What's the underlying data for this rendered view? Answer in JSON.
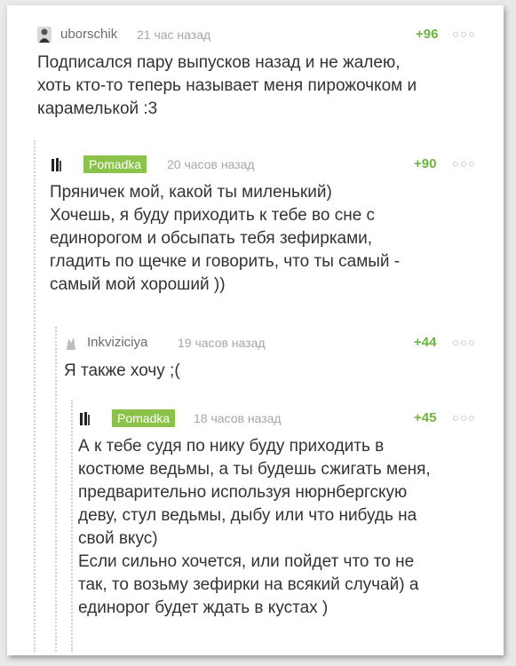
{
  "comments": [
    {
      "username": "uborschik",
      "time": "21 час назад",
      "rating": "+96",
      "avatar_icon": "user-avatar-icon",
      "is_author": false,
      "text": "Подписался пару выпусков назад и не жалею,\nхоть кто-то теперь называет меня пирожочком и\nкарамелькой :3"
    },
    {
      "username": "Pomadka",
      "time": "20 часов назад",
      "rating": "+90",
      "avatar_icon": "user-avatar-icon",
      "is_author": true,
      "text": "Пряничек мой, какой ты миленький)\nХочешь, я буду приходить к тебе во сне с\nединорогом и обсыпать тебя зефирками,\nгладить по щечке и говорить, что ты самый -\nсамый мой хороший ))"
    },
    {
      "username": "Inkviziciya",
      "time": "19 часов назад",
      "rating": "+44",
      "avatar_icon": "user-avatar-icon",
      "is_author": false,
      "text": "Я также хочу ;("
    },
    {
      "username": "Pomadka",
      "time": "18 часов назад",
      "rating": "+45",
      "avatar_icon": "user-avatar-icon",
      "is_author": true,
      "text": "А к тебе судя по нику буду приходить в\nкостюме ведьмы, а ты будешь сжигать меня,\nпредварительно используя нюрнбергскую\nдеву, стул ведьмы, дыбу или что нибудь на\nсвой вкус)\nЕсли сильно хочется, или пойдет что то не\nтак, то возьму зефирки на всякий случай) а\nединорог будет ждать в кустах )"
    }
  ],
  "colors": {
    "rating": "#6cb33f",
    "author_badge": "#8bc34a",
    "text": "#333333",
    "meta": "#a6a6a6"
  }
}
